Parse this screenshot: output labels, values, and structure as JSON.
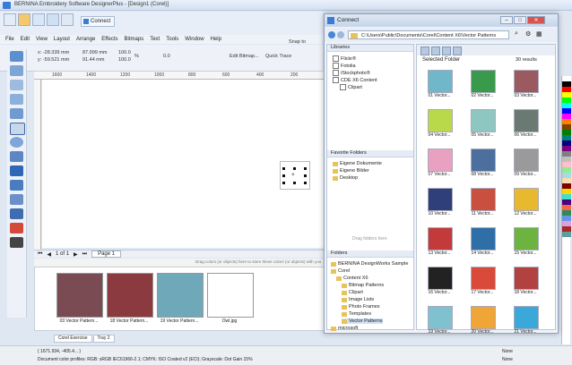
{
  "app": {
    "title": "BERNINA Embroidery Software DesignerPlus - [Design1 (Corel)]",
    "connect_label": "Connect",
    "menu": [
      "File",
      "Edit",
      "View",
      "Layout",
      "Arrange",
      "Effects",
      "Bitmaps",
      "Text",
      "Tools",
      "Window",
      "Help"
    ],
    "props": {
      "x": "x: -28.339 mm",
      "y": "y: -59.521 mm",
      "w": "87.999 mm",
      "h": "91.44 mm",
      "sx": "100.0",
      "sy": "100.0",
      "pct": "%",
      "angle": "0.0",
      "edit_bitmap": "Edit Bitmap...",
      "quick_trace": "Quick Trace",
      "snap": "Snap to"
    },
    "ruler": [
      "1600",
      "1400",
      "1200",
      "1000",
      "800",
      "600",
      "400",
      "200"
    ],
    "pagebar": {
      "page_of": "1 of 1",
      "page_tab": "Page 1"
    },
    "hint": "Drag colors (or objects) here to store these colors (or objects) with your document",
    "tray": {
      "items": [
        {
          "label": "03 Vector Pattern...",
          "color": "#7a4b52"
        },
        {
          "label": "18 Vector Pattern...",
          "color": "#8b3a3f"
        },
        {
          "label": "19 Vector Pattern...",
          "color": "#6fa8b8"
        },
        {
          "label": "Owl.jpg",
          "color": "#ffffff"
        }
      ],
      "tabs": [
        "Corel Exercise",
        "Tray 2"
      ]
    },
    "status": {
      "coords": "( 1671.934, -405.4... )",
      "profiles": "Document color profiles: RGB: sRGB IEC61966-2.1; CMYK: ISO Coated v2 (ECI); Grayscale: Dot Gain 15%",
      "fill1": "None",
      "fill2": "None"
    }
  },
  "connect": {
    "title": "Connect",
    "path": "C:\\Users\\Public\\Documents\\Corel\\Content X6\\Vector Patterns",
    "libraries_header": "Libraries",
    "libraries": [
      {
        "label": "Flickr®",
        "checked": true
      },
      {
        "label": "Fotolia",
        "checked": true
      },
      {
        "label": "iStockphoto®",
        "checked": true
      },
      {
        "label": "CDE X6 Content",
        "checked": true
      },
      {
        "label": "Clipart",
        "checked": true
      }
    ],
    "favorites_header": "Favorite Folders",
    "favorites": [
      {
        "label": "Eigene Dokumente"
      },
      {
        "label": "Eigene Bilder"
      },
      {
        "label": "Desktop"
      }
    ],
    "drag_hint": "Drag folders here",
    "folders_header": "Folders",
    "folders": [
      {
        "label": "BERNINA DesignWorks Sample"
      },
      {
        "label": "Corel"
      },
      {
        "label": "Content X6"
      },
      {
        "label": "Bitmap Patterns"
      },
      {
        "label": "Clipart"
      },
      {
        "label": "Image Lists"
      },
      {
        "label": "Photo Frames"
      },
      {
        "label": "Templates"
      },
      {
        "label": "Vector Patterns"
      },
      {
        "label": "microsoft"
      }
    ],
    "selected_header": "Selected Folder",
    "results": "30 results",
    "patterns": [
      {
        "label": "01 Vector...",
        "color": "#6fb7c9"
      },
      {
        "label": "02 Vector...",
        "color": "#3a9a4b"
      },
      {
        "label": "03 Vector...",
        "color": "#9b5a5f"
      },
      {
        "label": "04 Vector...",
        "color": "#b9d94a"
      },
      {
        "label": "05 Vector...",
        "color": "#8ec6c2"
      },
      {
        "label": "06 Vector...",
        "color": "#6a7a72"
      },
      {
        "label": "07 Vector...",
        "color": "#e9a0c1"
      },
      {
        "label": "08 Vector...",
        "color": "#4c6f9e"
      },
      {
        "label": "09 Vector...",
        "color": "#9a9a9a"
      },
      {
        "label": "10 Vector...",
        "color": "#2f3f7a"
      },
      {
        "label": "11 Vector...",
        "color": "#c9503f"
      },
      {
        "label": "12 Vector...",
        "color": "#e8b92f"
      },
      {
        "label": "13 Vector...",
        "color": "#c23a3a"
      },
      {
        "label": "14 Vector...",
        "color": "#2e6fa8"
      },
      {
        "label": "15 Vector...",
        "color": "#6db33f"
      },
      {
        "label": "16 Vector...",
        "color": "#222222"
      },
      {
        "label": "17 Vector...",
        "color": "#d94a3a"
      },
      {
        "label": "18 Vector...",
        "color": "#b2423f"
      },
      {
        "label": "19 Vector...",
        "color": "#7fc1cf"
      },
      {
        "label": "20 Vector...",
        "color": "#f0a636"
      },
      {
        "label": "21 Vector...",
        "color": "#3aa8d8"
      }
    ]
  },
  "palette": [
    "#ffffff",
    "#000000",
    "#ff0000",
    "#ffff00",
    "#00ff00",
    "#00ffff",
    "#0000ff",
    "#ff00ff",
    "#ff8000",
    "#804000",
    "#008000",
    "#008080",
    "#000080",
    "#800080",
    "#808080",
    "#c0c0c0",
    "#ffc0cb",
    "#90ee90",
    "#add8e6",
    "#f5deb3",
    "#800000",
    "#ffd700",
    "#40e0d0",
    "#4b0082",
    "#ff6347",
    "#2e8b57",
    "#6495ed",
    "#dda0dd",
    "#a52a2a",
    "#5f9ea0"
  ]
}
